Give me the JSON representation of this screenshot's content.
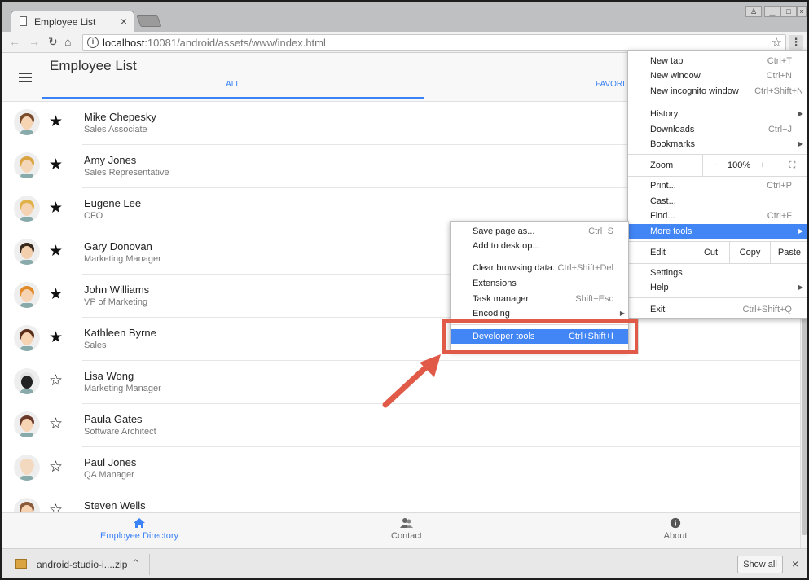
{
  "browser": {
    "tab_title": "Employee List",
    "url_host": "localhost",
    "url_rest": ":10081/android/assets/www/index.html"
  },
  "app": {
    "title": "Employee List",
    "tab_all": "ALL",
    "tab_favorites": "FAVORIT"
  },
  "employees": [
    {
      "name": "Mike Chepesky",
      "title": "Sales Associate",
      "favorite": true
    },
    {
      "name": "Amy Jones",
      "title": "Sales Representative",
      "favorite": true
    },
    {
      "name": "Eugene Lee",
      "title": "CFO",
      "favorite": true
    },
    {
      "name": "Gary Donovan",
      "title": "Marketing Manager",
      "favorite": true
    },
    {
      "name": "John Williams",
      "title": "VP of Marketing",
      "favorite": true
    },
    {
      "name": "Kathleen Byrne",
      "title": "Sales",
      "favorite": true
    },
    {
      "name": "Lisa Wong",
      "title": "Marketing Manager",
      "favorite": false
    },
    {
      "name": "Paula Gates",
      "title": "Software Architect",
      "favorite": false
    },
    {
      "name": "Paul Jones",
      "title": "QA Manager",
      "favorite": false
    },
    {
      "name": "Steven Wells",
      "title": "",
      "favorite": false
    }
  ],
  "bottom_nav": {
    "directory": "Employee Directory",
    "contact": "Contact",
    "about": "About"
  },
  "menu": {
    "new_tab": "New tab",
    "new_tab_sc": "Ctrl+T",
    "new_window": "New window",
    "new_window_sc": "Ctrl+N",
    "new_incognito": "New incognito window",
    "new_incognito_sc": "Ctrl+Shift+N",
    "history": "History",
    "downloads": "Downloads",
    "downloads_sc": "Ctrl+J",
    "bookmarks": "Bookmarks",
    "zoom": "Zoom",
    "zoom_minus": "−",
    "zoom_value": "100%",
    "zoom_plus": "+",
    "print": "Print...",
    "print_sc": "Ctrl+P",
    "cast": "Cast...",
    "find": "Find...",
    "find_sc": "Ctrl+F",
    "more_tools": "More tools",
    "edit": "Edit",
    "cut": "Cut",
    "copy": "Copy",
    "paste": "Paste",
    "settings": "Settings",
    "help": "Help",
    "exit": "Exit",
    "exit_sc": "Ctrl+Shift+Q"
  },
  "submenu": {
    "save_page": "Save page as...",
    "save_page_sc": "Ctrl+S",
    "add_desktop": "Add to desktop...",
    "clear_data": "Clear browsing data...",
    "clear_data_sc": "Ctrl+Shift+Del",
    "extensions": "Extensions",
    "task_manager": "Task manager",
    "task_manager_sc": "Shift+Esc",
    "encoding": "Encoding",
    "dev_tools": "Developer tools",
    "dev_tools_sc": "Ctrl+Shift+I"
  },
  "shelf": {
    "download_name": "android-studio-i....zip",
    "show_all": "Show all"
  },
  "colors": {
    "accent": "#3b82f6",
    "highlight": "#4285f4",
    "callout": "#e05a47"
  }
}
